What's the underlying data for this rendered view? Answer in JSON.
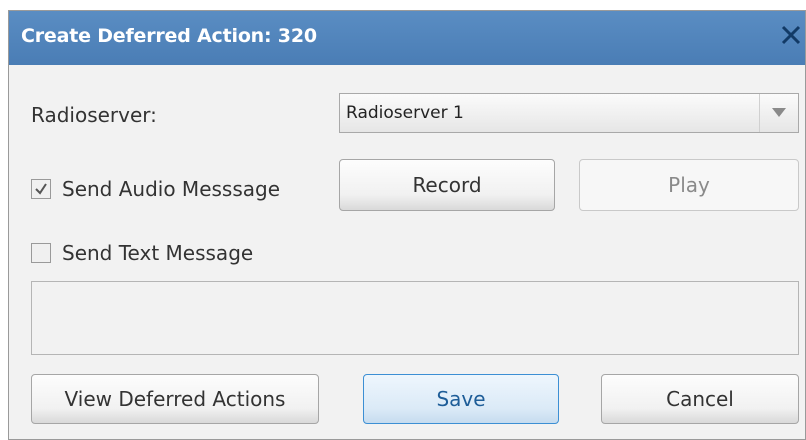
{
  "dialog": {
    "title": "Create Deferred Action: 320",
    "close_icon": "close-icon"
  },
  "radioserver": {
    "label": "Radioserver:",
    "selected": "Radioserver 1"
  },
  "audio": {
    "checked": true,
    "label": "Send Audio Messsage",
    "record_label": "Record",
    "play_label": "Play",
    "play_enabled": false
  },
  "text": {
    "checked": false,
    "label": "Send Text Message",
    "message": ""
  },
  "footer": {
    "view_label": "View Deferred Actions",
    "save_label": "Save",
    "cancel_label": "Cancel"
  },
  "colors": {
    "titlebar": "#4f86bf",
    "dialog_bg": "#f2f2f2",
    "primary_border": "#3c8fd4"
  }
}
